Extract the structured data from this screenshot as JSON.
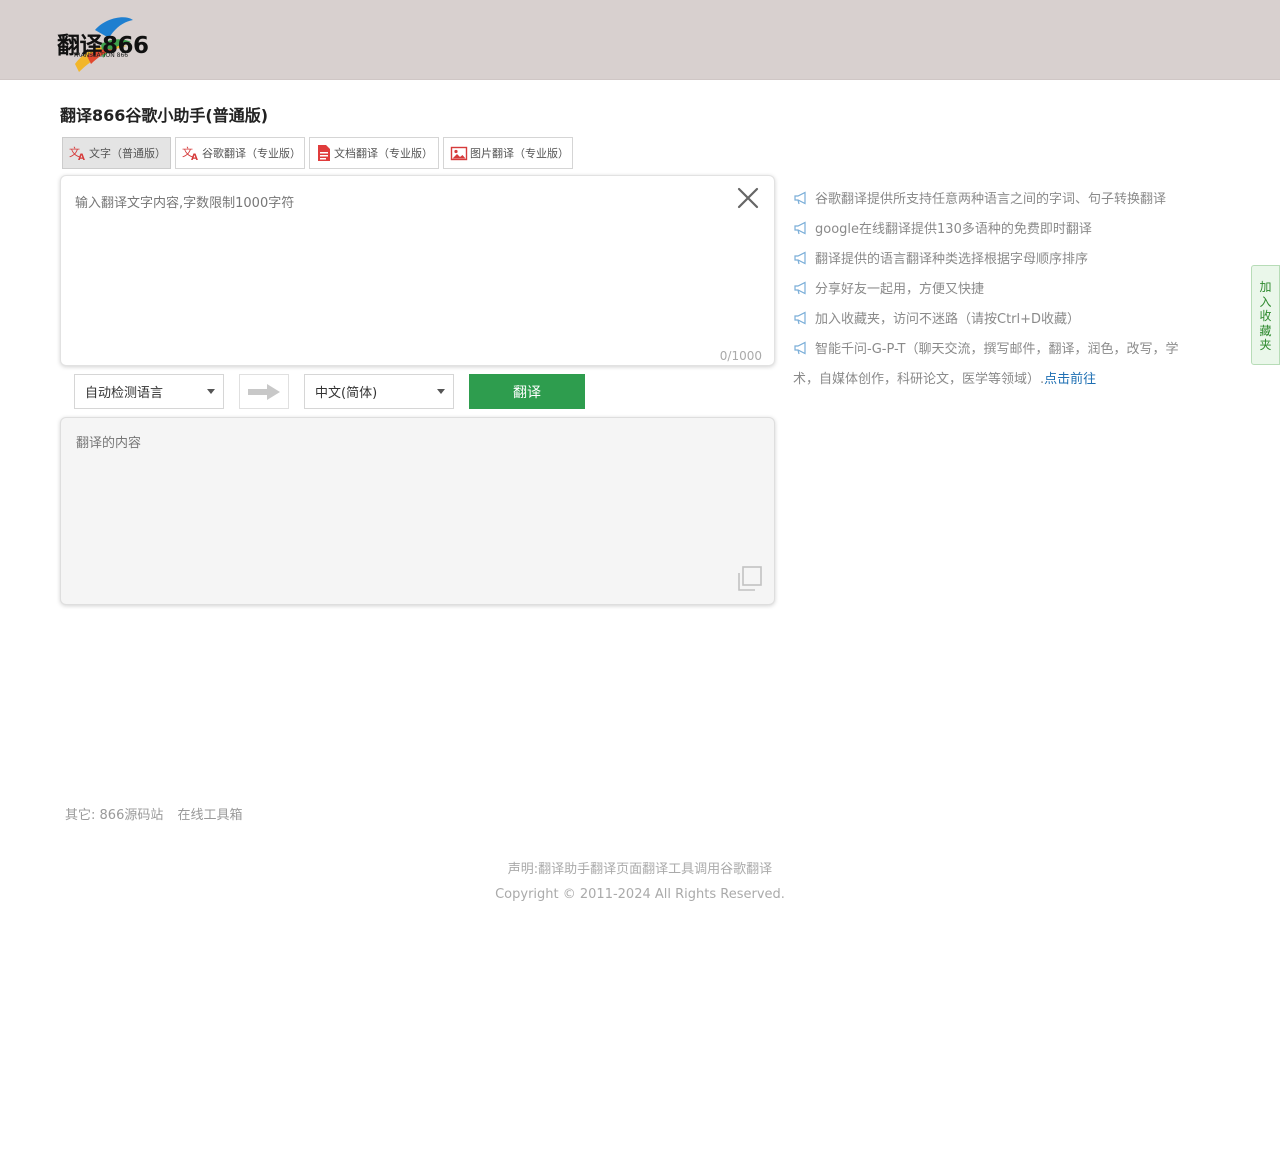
{
  "header": {
    "logo_text": "翻译866",
    "logo_subtext": "TRANSLATION 866"
  },
  "page": {
    "title": "翻译866谷歌小助手(普通版)"
  },
  "tabs": [
    {
      "label": "文字（普通版）",
      "icon": "translate-icon",
      "active": true
    },
    {
      "label": "谷歌翻译（专业版）",
      "icon": "translate-icon",
      "active": false
    },
    {
      "label": "文档翻译（专业版）",
      "icon": "document-icon",
      "active": false
    },
    {
      "label": "图片翻译（专业版）",
      "icon": "image-icon",
      "active": false
    }
  ],
  "source": {
    "placeholder": "输入翻译文字内容,字数限制1000字符",
    "value": "",
    "counter": "0/1000"
  },
  "controls": {
    "source_lang": "自动检测语言",
    "target_lang": "中文(简体)",
    "translate_label": "翻译"
  },
  "output": {
    "placeholder": "翻译的内容"
  },
  "tips": [
    "谷歌翻译提供所支持任意两种语言之间的字词、句子转换翻译",
    "google在线翻译提供130多语种的免费即时翻译",
    "翻译提供的语言翻译种类选择根据字母顺序排序",
    "分享好友一起用，方便又快捷",
    "加入收藏夹，访问不迷路（请按Ctrl+D收藏）",
    "智能千问-G-P-T（聊天交流，撰写邮件，翻译，润色，改写，学术，自媒体创作，科研论文，医学等领域）."
  ],
  "tip_link": "点击前往",
  "bookmark": {
    "chars": [
      "加",
      "入",
      "收",
      "藏",
      "夹"
    ]
  },
  "links": {
    "prefix": "其它:",
    "items": [
      "866源码站",
      "在线工具箱"
    ]
  },
  "footer": {
    "statement": "声明:翻译助手翻译页面翻译工具调用谷歌翻译",
    "copyright": "Copyright © 2011-2024 All Rights Reserved."
  },
  "colors": {
    "header_bg": "#d8d0cf",
    "translate_button": "#2e9d4e",
    "link": "#1e6fb3",
    "bookmark_text": "#2f8a2f"
  }
}
